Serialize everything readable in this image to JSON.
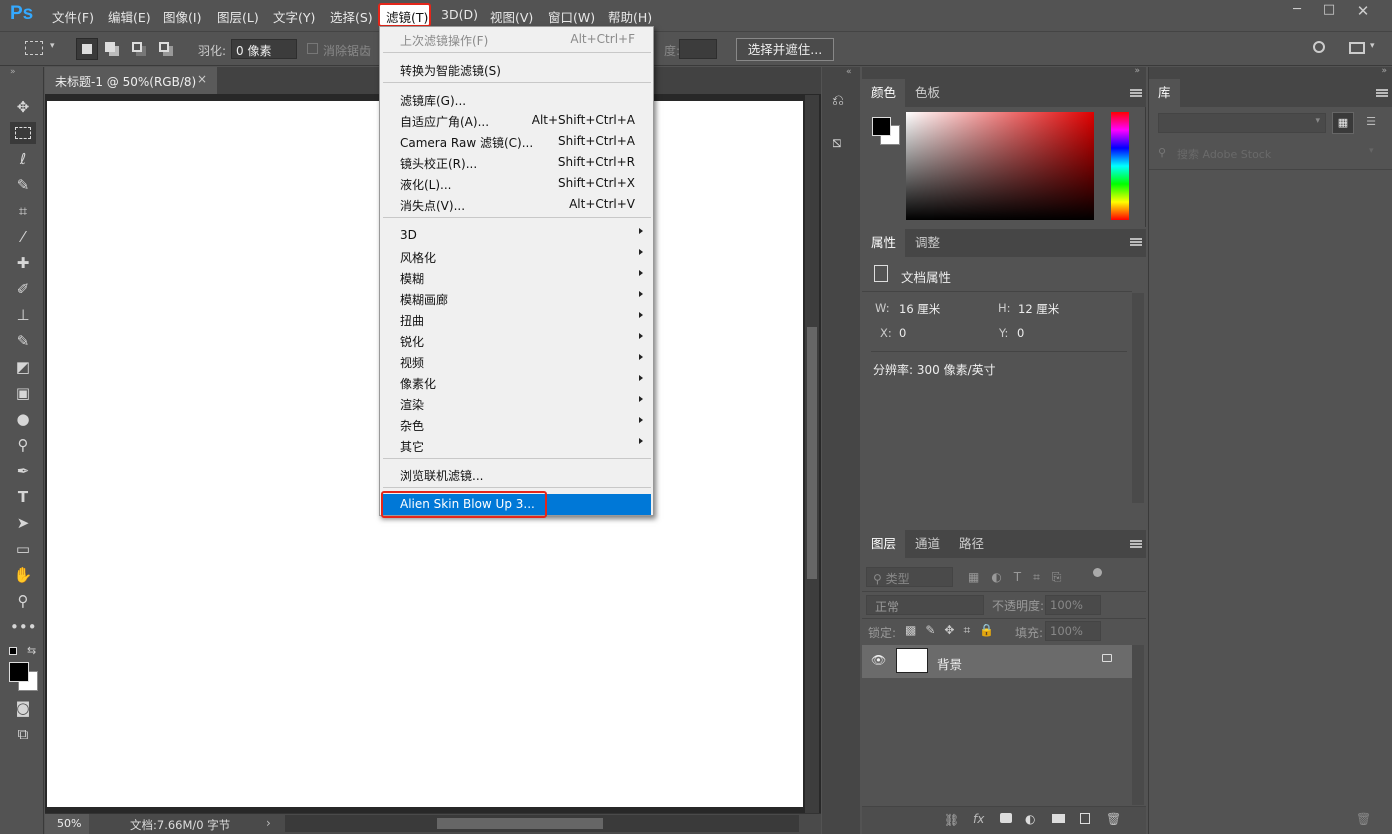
{
  "app": {
    "logo": "Ps"
  },
  "menubar": {
    "items": [
      "文件(F)",
      "编辑(E)",
      "图像(I)",
      "图层(L)",
      "文字(Y)",
      "选择(S)",
      "滤镜(T)",
      "3D(D)",
      "视图(V)",
      "窗口(W)",
      "帮助(H)"
    ]
  },
  "options": {
    "feather_label": "羽化:",
    "feather_value": "0 像素",
    "antialias_label": "消除锯齿",
    "density_label": "度:",
    "select_mask_label": "选择并遮住..."
  },
  "document": {
    "tab_title": "未标题-1 @ 50%(RGB/8)",
    "close": "×",
    "zoom": "50%",
    "status": "文档:7.66M/0 字节"
  },
  "filter_menu": {
    "last_filter": "上次滤镜操作(F)",
    "last_filter_sc": "Alt+Ctrl+F",
    "smart": "转换为智能滤镜(S)",
    "gallery": "滤镜库(G)...",
    "adaptive": "自适应广角(A)...",
    "adaptive_sc": "Alt+Shift+Ctrl+A",
    "camera_raw": "Camera Raw 滤镜(C)...",
    "camera_raw_sc": "Shift+Ctrl+A",
    "lens": "镜头校正(R)...",
    "lens_sc": "Shift+Ctrl+R",
    "liquify": "液化(L)...",
    "liquify_sc": "Shift+Ctrl+X",
    "vanish": "消失点(V)...",
    "vanish_sc": "Alt+Ctrl+V",
    "submenus": [
      "3D",
      "风格化",
      "模糊",
      "模糊画廊",
      "扭曲",
      "锐化",
      "视频",
      "像素化",
      "渲染",
      "杂色",
      "其它"
    ],
    "browse": "浏览联机滤镜...",
    "alien": "Alien Skin Blow Up 3..."
  },
  "color_panel": {
    "tabs": [
      "颜色",
      "色板"
    ]
  },
  "library_panel": {
    "tab": "库",
    "search_placeholder": "搜索 Adobe Stock"
  },
  "properties_panel": {
    "tabs": [
      "属性",
      "调整"
    ],
    "title": "文档属性",
    "w_label": "W:",
    "w_value": "16 厘米",
    "h_label": "H:",
    "h_value": "12 厘米",
    "x_label": "X:",
    "x_value": "0",
    "y_label": "Y:",
    "y_value": "0",
    "resolution": "分辨率: 300 像素/英寸"
  },
  "layers_panel": {
    "tabs": [
      "图层",
      "通道",
      "路径"
    ],
    "filter_kind": "类型",
    "blend_mode": "正常",
    "opacity_label": "不透明度:",
    "opacity_value": "100%",
    "lock_label": "锁定:",
    "fill_label": "填充:",
    "fill_value": "100%",
    "layer_name": "背景"
  },
  "colors": {
    "accent": "#0078d7",
    "highlight": "#e4261a"
  }
}
